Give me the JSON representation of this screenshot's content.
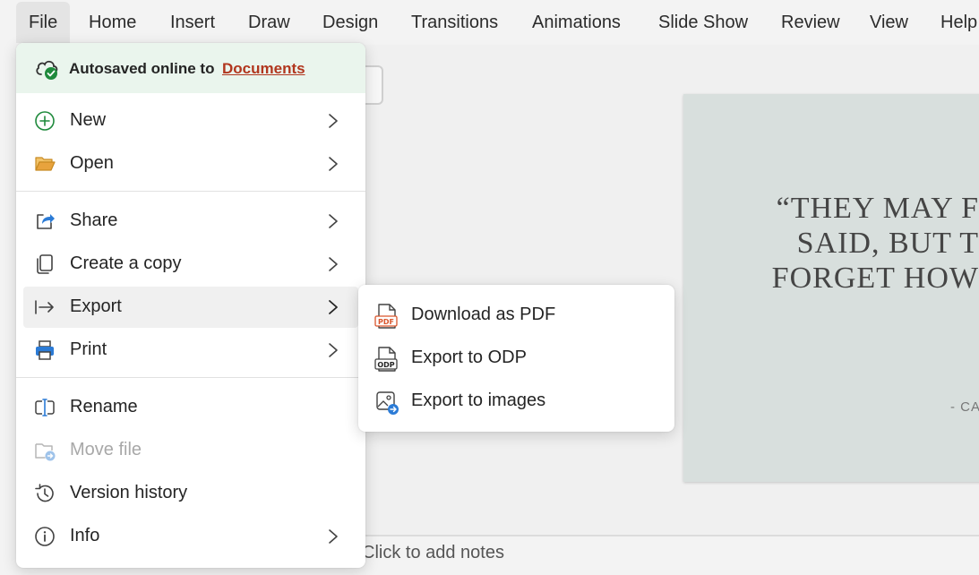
{
  "ribbon": {
    "tabs": [
      {
        "label": "File",
        "active": true
      },
      {
        "label": "Home"
      },
      {
        "label": "Insert"
      },
      {
        "label": "Draw"
      },
      {
        "label": "Design"
      },
      {
        "label": "Transitions"
      },
      {
        "label": "Animations"
      },
      {
        "label": "Slide Show"
      },
      {
        "label": "Review"
      },
      {
        "label": "View"
      },
      {
        "label": "Help"
      }
    ]
  },
  "file_menu": {
    "autosave": {
      "text": "Autosaved online to",
      "link": "Documents",
      "icon": "cloud-check-icon"
    },
    "items": [
      {
        "label": "New",
        "icon": "plus-circle-icon",
        "has_submenu": true
      },
      {
        "label": "Open",
        "icon": "folder-open-icon",
        "has_submenu": true
      },
      {
        "label": "Share",
        "icon": "share-icon",
        "has_submenu": true
      },
      {
        "label": "Create a copy",
        "icon": "copy-icon",
        "has_submenu": true
      },
      {
        "label": "Export",
        "icon": "export-arrow-icon",
        "has_submenu": true,
        "hovered": true
      },
      {
        "label": "Print",
        "icon": "printer-icon",
        "has_submenu": true
      },
      {
        "label": "Rename",
        "icon": "rename-icon",
        "has_submenu": false
      },
      {
        "label": "Move file",
        "icon": "move-file-icon",
        "has_submenu": false,
        "disabled": true
      },
      {
        "label": "Version history",
        "icon": "history-icon",
        "has_submenu": false
      },
      {
        "label": "Info",
        "icon": "info-icon",
        "has_submenu": true
      }
    ]
  },
  "export_submenu": {
    "items": [
      {
        "label": "Download as PDF",
        "icon": "pdf-file-icon"
      },
      {
        "label": "Export to ODP",
        "icon": "odp-file-icon"
      },
      {
        "label": "Export to images",
        "icon": "image-export-icon"
      }
    ]
  },
  "slide": {
    "quote_lines": [
      "“THEY MAY F",
      "SAID, BUT T",
      "FORGET HOW"
    ],
    "author": "- CA"
  },
  "notes": {
    "placeholder": "Click to add notes"
  },
  "colors": {
    "accent_link": "#b1361e",
    "autosave_bg": "#eaf5ed",
    "slide_bg": "#d8dfdd",
    "check_green": "#1f8a3c",
    "folder_yellow": "#e8a33d",
    "print_blue": "#2b7bd6",
    "pdf_orange": "#d9542b"
  }
}
